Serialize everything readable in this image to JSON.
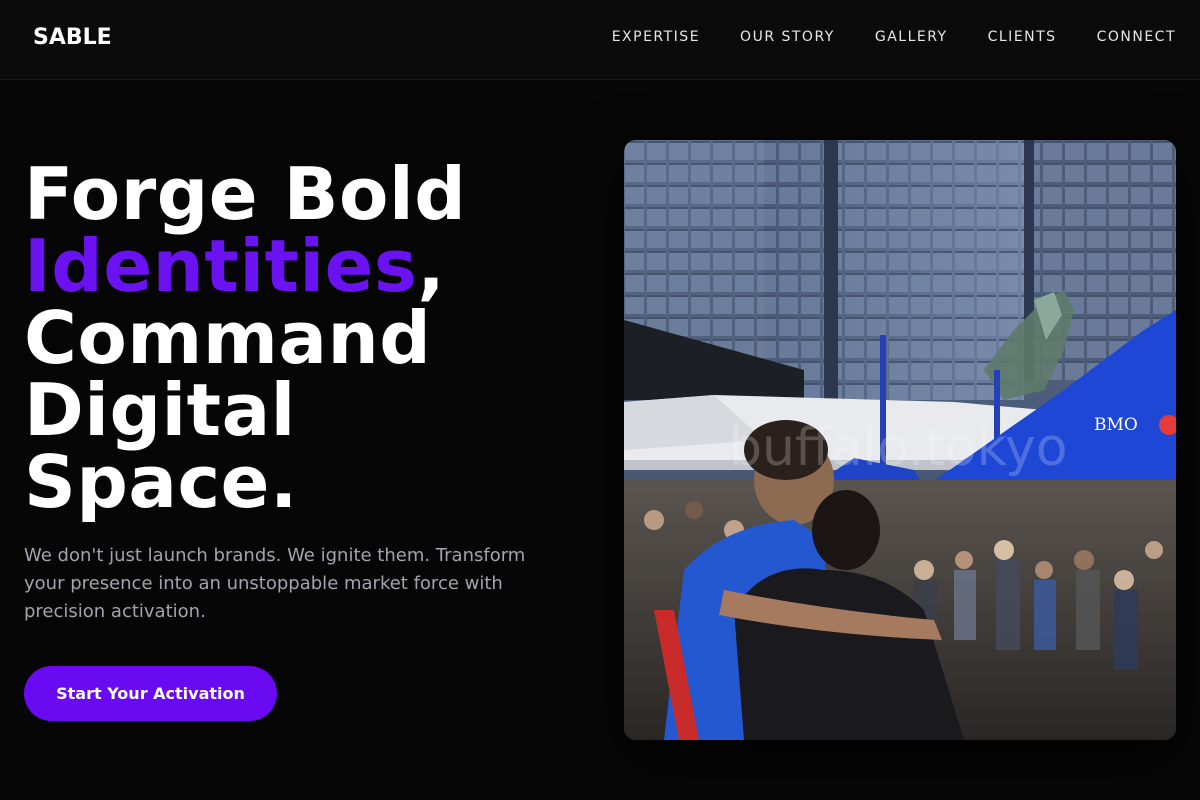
{
  "nav": {
    "brand": "SABLE",
    "links": [
      "EXPERTISE",
      "OUR STORY",
      "GALLERY",
      "CLIENTS",
      "CONNECT"
    ]
  },
  "hero": {
    "title_line1": "Forge Bold",
    "title_accent": "Identities",
    "title_comma": ",",
    "title_line3": "Command",
    "title_line4": "Digital",
    "title_line5": "Space.",
    "subtitle": "We don't just launch brands. We ignite them. Transform your presence into an unstoppable market force with precision activation.",
    "cta_label": "Start Your Activation"
  },
  "photo": {
    "tent_logo": "BMO",
    "watermark": "buffalo.tokyo"
  },
  "colors": {
    "accent": "#6a12f2",
    "button": "#6a0af2",
    "background": "#060607",
    "nav_background": "#0b0b0c",
    "subtitle_text": "#a3a3ad"
  }
}
